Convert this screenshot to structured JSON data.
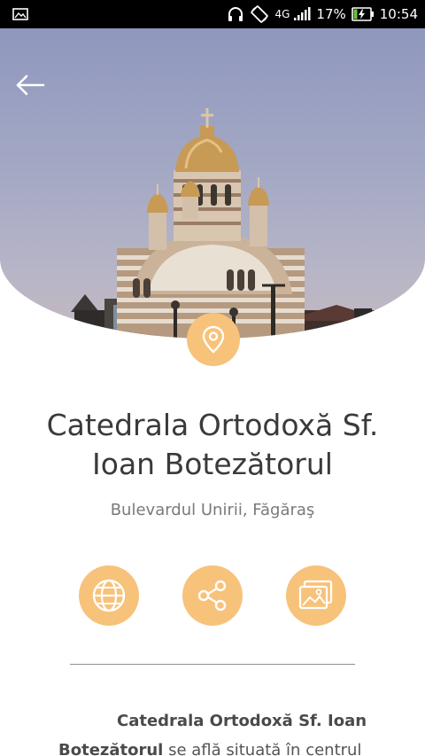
{
  "statusbar": {
    "network": "4G",
    "battery": "17%",
    "time": "10:54",
    "icons": [
      "image-notification-icon",
      "headphones-icon",
      "screen-rotation-icon",
      "signal-icon",
      "battery-charging-icon"
    ]
  },
  "colors": {
    "accent": "#f7c27a",
    "title": "#3a3a3a",
    "subtitle": "#7a7a7a"
  },
  "place": {
    "name": "Catedrala Ortodoxă Sf. Ioan Botezătorul",
    "address": "Bulevardul Unirii, Făgăraş"
  },
  "actions": [
    "globe-icon",
    "share-icon",
    "gallery-icon"
  ],
  "description": {
    "bold": "Catedrala Ortodoxă Sf. Ioan Botezătorul",
    "text": " se află situată în centrul"
  }
}
